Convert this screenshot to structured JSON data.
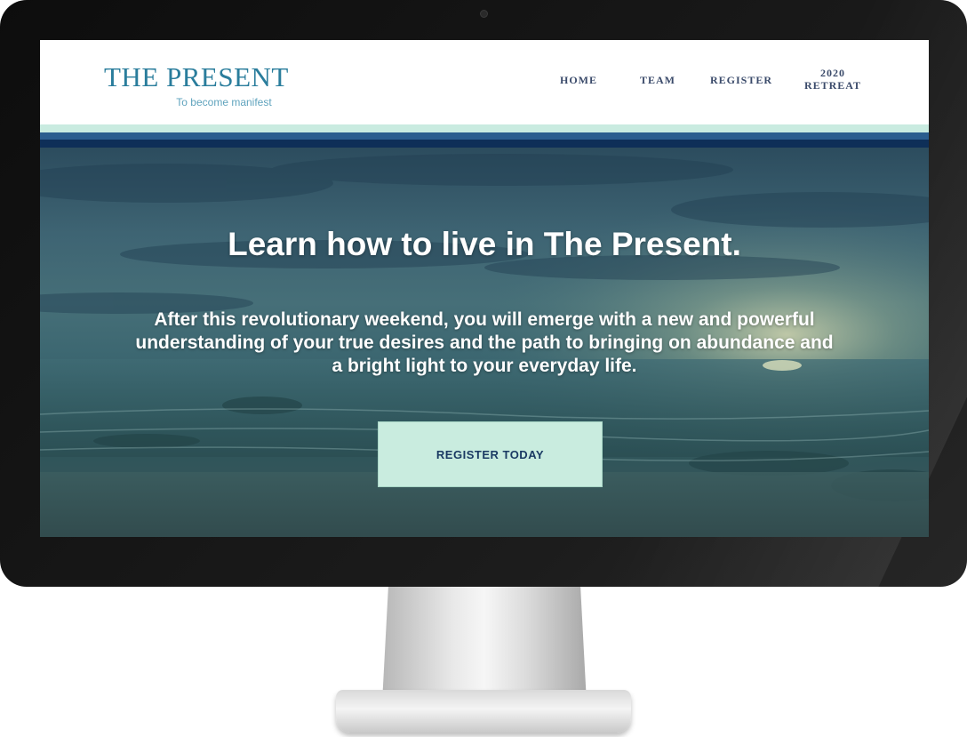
{
  "site": {
    "logo_title": "THE PRESENT",
    "logo_tagline": "To become manifest"
  },
  "nav": {
    "home": "HOME",
    "team": "TEAM",
    "register": "REGISTER",
    "retreat_line1": "2020",
    "retreat_line2": "RETREAT"
  },
  "hero": {
    "title": "Learn how to live in The Present.",
    "body": "After this revolutionary weekend, you will emerge with a new and powerful understanding of your true desires and the path to bringing on abundance and a bright light to your everyday life.",
    "cta_label": "REGISTER TODAY"
  },
  "colors": {
    "brand": "#2a7d9c",
    "nav_text": "#3a4a6a",
    "stripe_light": "#c9ebe0",
    "stripe_mid": "#2b5d8e",
    "stripe_dark": "#0e2f58",
    "cta_background": "#c9ecdf",
    "cta_text": "#1a3a63"
  }
}
